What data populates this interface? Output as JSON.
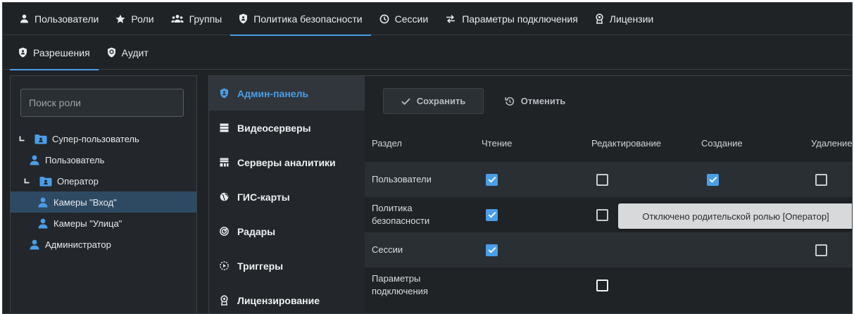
{
  "nav": {
    "tabs": [
      {
        "label": "Пользователи",
        "icon": "person-icon"
      },
      {
        "label": "Роли",
        "icon": "star-icon"
      },
      {
        "label": "Группы",
        "icon": "group-icon"
      },
      {
        "label": "Политика безопасности",
        "icon": "shield-icon",
        "active": true
      },
      {
        "label": "Сессии",
        "icon": "clock-icon"
      },
      {
        "label": "Параметры подключения",
        "icon": "connection-icon"
      },
      {
        "label": "Лицензии",
        "icon": "license-icon"
      }
    ]
  },
  "subnav": {
    "tabs": [
      {
        "label": "Разрешения",
        "icon": "lock-shield-icon",
        "active": true
      },
      {
        "label": "Аудит",
        "icon": "audit-icon"
      }
    ]
  },
  "roles": {
    "search_placeholder": "Поиск роли",
    "tree": [
      {
        "label": "Супер-пользователь",
        "type": "group",
        "expanded": true
      },
      {
        "label": "Пользователь",
        "type": "user"
      },
      {
        "label": "Оператор",
        "type": "group",
        "expanded": true
      },
      {
        "label": "Камеры \"Вход\"",
        "type": "user",
        "selected": true
      },
      {
        "label": "Камеры \"Улица\"",
        "type": "user"
      },
      {
        "label": "Администратор",
        "type": "user"
      }
    ]
  },
  "sections": {
    "items": [
      {
        "label": "Админ-панель",
        "icon": "admin-shield-icon",
        "active": true
      },
      {
        "label": "Видеосерверы",
        "icon": "server-icon"
      },
      {
        "label": "Серверы аналитики",
        "icon": "analytics-server-icon"
      },
      {
        "label": "ГИС-карты",
        "icon": "globe-icon"
      },
      {
        "label": "Радары",
        "icon": "radar-icon"
      },
      {
        "label": "Триггеры",
        "icon": "trigger-icon"
      },
      {
        "label": "Лицензирование",
        "icon": "license-icon"
      }
    ]
  },
  "toolbar": {
    "save_label": "Сохранить",
    "cancel_label": "Отменить"
  },
  "permissions": {
    "columns": [
      "Раздел",
      "Чтение",
      "Редактирование",
      "Создание",
      "Удаление"
    ],
    "rows": [
      {
        "name": "Пользователи",
        "read": true,
        "edit": false,
        "create": true,
        "delete": false
      },
      {
        "name": "Политика безопасности",
        "read": true,
        "edit": false,
        "create": null,
        "delete": null
      },
      {
        "name": "Сессии",
        "read": true,
        "edit": null,
        "create": null,
        "delete": false
      },
      {
        "name": "Параметры подключения",
        "read": null,
        "edit": false,
        "create": null,
        "delete": null
      }
    ]
  },
  "tooltip": {
    "text": "Отключено родительской ролью [Оператор]"
  },
  "colors": {
    "accent": "#4a9ee8",
    "background": "#1f2326",
    "selected_row": "#2e4a63"
  }
}
